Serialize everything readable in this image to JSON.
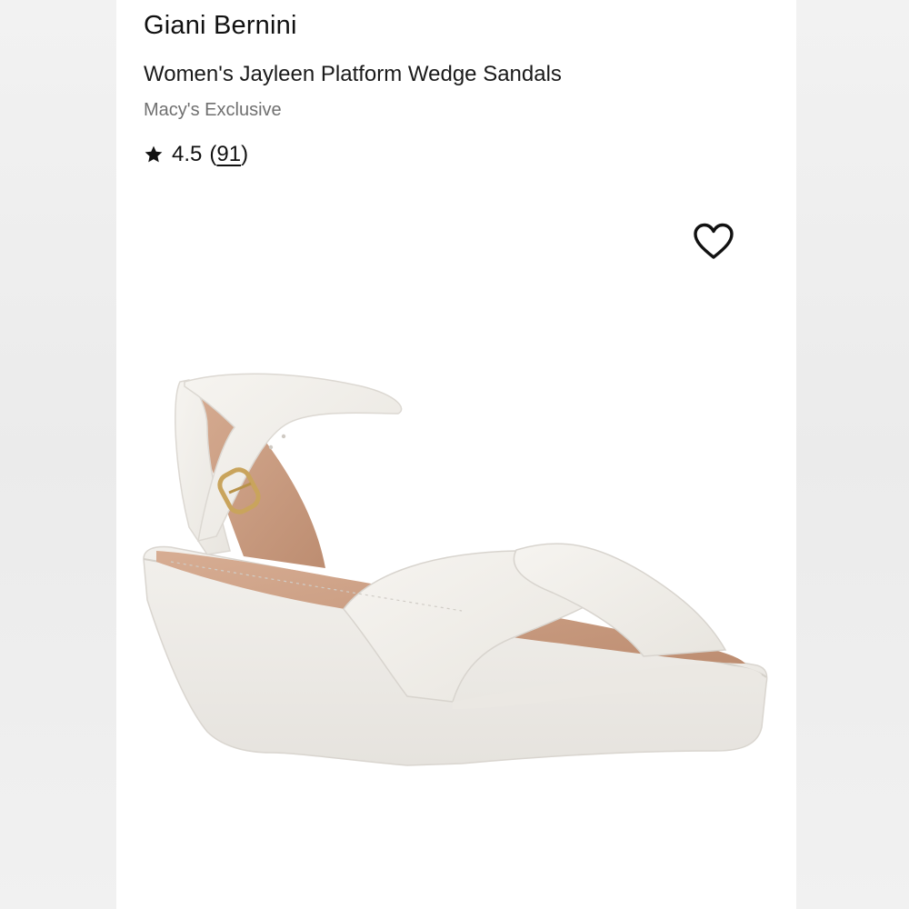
{
  "product": {
    "brand": "Giani Bernini",
    "title": "Women's Jayleen Platform Wedge Sandals",
    "exclusive": "Macy's Exclusive",
    "rating": {
      "value": "4.5",
      "open_paren": "(",
      "count": "91",
      "close_paren": ")"
    },
    "icons": {
      "rating": "star-icon",
      "favorite": "heart-outline-icon"
    },
    "image_alt": "white platform wedge sandal",
    "colors": {
      "upper": "#f3f1ed",
      "footbed": "#c99a7f",
      "buckle": "#c9a45c"
    }
  }
}
